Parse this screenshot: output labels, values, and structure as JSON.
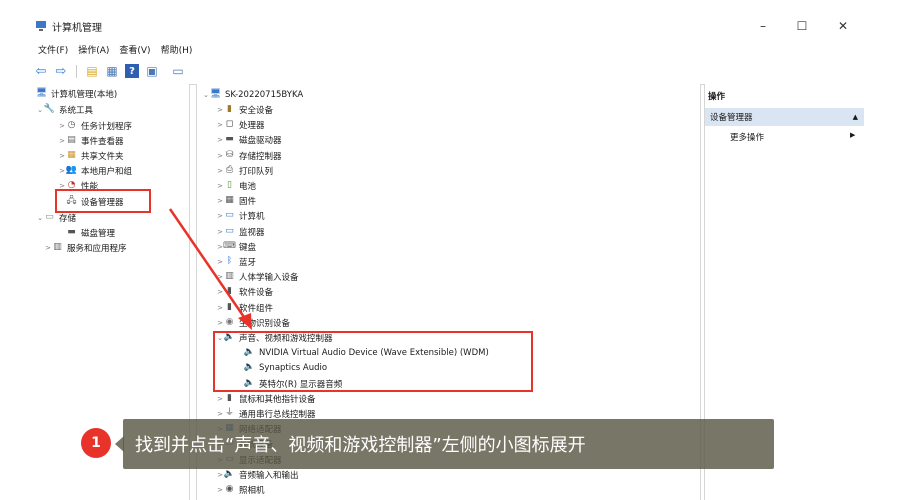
{
  "window": {
    "title": "计算机管理",
    "minimize_glyph": "–",
    "maximize_glyph": "☐",
    "close_glyph": "✕"
  },
  "menu": [
    {
      "label": "文件(F)"
    },
    {
      "label": "操作(A)"
    },
    {
      "label": "查看(V)"
    },
    {
      "label": "帮助(H)"
    }
  ],
  "toolbar": [
    {
      "icon": "back-icon",
      "glyph": "⇦",
      "color": "#2f7fd6"
    },
    {
      "icon": "forward-icon",
      "glyph": "⇨",
      "color": "#2f7fd6"
    },
    {
      "icon": "up-folder-icon",
      "glyph": "▤",
      "color": "#d9a520"
    },
    {
      "icon": "show-hide-tree-icon",
      "glyph": "▦",
      "color": "#4a79b5"
    },
    {
      "icon": "help-icon",
      "glyph": "?",
      "color": "#2f5fb0"
    },
    {
      "icon": "properties-icon",
      "glyph": "▣",
      "color": "#4a79b5"
    },
    {
      "icon": "console-icon",
      "glyph": "▭",
      "color": "#4a79b5"
    }
  ],
  "left_tree": [
    {
      "label": "计算机管理(本地)",
      "icon": "computer-management-icon",
      "glyph": "🖥",
      "expander": ""
    },
    {
      "label": "系统工具",
      "icon": "system-tools-icon",
      "glyph": "🔧",
      "expander": "⌄"
    },
    {
      "label": "任务计划程序",
      "icon": "task-scheduler-icon",
      "glyph": "◷",
      "expander": ">"
    },
    {
      "label": "事件查看器",
      "icon": "event-viewer-icon",
      "glyph": "▤",
      "expander": ">"
    },
    {
      "label": "共享文件夹",
      "icon": "shared-folders-icon",
      "glyph": "▦",
      "expander": ">"
    },
    {
      "label": "本地用户和组",
      "icon": "local-users-icon",
      "glyph": "👥",
      "expander": ">"
    },
    {
      "label": "性能",
      "icon": "performance-icon",
      "glyph": "◔",
      "expander": ">"
    },
    {
      "label": "设备管理器",
      "icon": "device-manager-icon",
      "glyph": "🖧",
      "expander": ""
    },
    {
      "label": "存储",
      "icon": "storage-icon",
      "glyph": "▭",
      "expander": "⌄"
    },
    {
      "label": "磁盘管理",
      "icon": "disk-management-icon",
      "glyph": "▬",
      "expander": ""
    },
    {
      "label": "服务和应用程序",
      "icon": "services-apps-icon",
      "glyph": "▥",
      "expander": ">"
    }
  ],
  "device_tree": {
    "root": {
      "label": "SK-20220715BYKA",
      "icon": "computer-icon",
      "glyph": "🖥"
    },
    "items": [
      {
        "label": "安全设备",
        "icon": "security-device-icon",
        "glyph": "▮",
        "expander": ">"
      },
      {
        "label": "处理器",
        "icon": "processor-icon",
        "glyph": "◻",
        "expander": ">"
      },
      {
        "label": "磁盘驱动器",
        "icon": "disk-drive-icon",
        "glyph": "▬",
        "expander": ">"
      },
      {
        "label": "存储控制器",
        "icon": "storage-controller-icon",
        "glyph": "⛁",
        "expander": ">"
      },
      {
        "label": "打印队列",
        "icon": "print-queue-icon",
        "glyph": "⎙",
        "expander": ">"
      },
      {
        "label": "电池",
        "icon": "battery-icon",
        "glyph": "▯",
        "expander": ">"
      },
      {
        "label": "固件",
        "icon": "firmware-icon",
        "glyph": "▦",
        "expander": ">"
      },
      {
        "label": "计算机",
        "icon": "computer-node-icon",
        "glyph": "▭",
        "expander": ">"
      },
      {
        "label": "监视器",
        "icon": "monitor-icon",
        "glyph": "▭",
        "expander": ">"
      },
      {
        "label": "键盘",
        "icon": "keyboard-icon",
        "glyph": "⌨",
        "expander": ">"
      },
      {
        "label": "蓝牙",
        "icon": "bluetooth-icon",
        "glyph": "ᛒ",
        "expander": ">"
      },
      {
        "label": "人体学输入设备",
        "icon": "hid-icon",
        "glyph": "▥",
        "expander": ">"
      },
      {
        "label": "软件设备",
        "icon": "software-device-icon",
        "glyph": "▮",
        "expander": ">"
      },
      {
        "label": "软件组件",
        "icon": "software-component-icon",
        "glyph": "▮",
        "expander": ">"
      },
      {
        "label": "生物识别设备",
        "icon": "biometric-icon",
        "glyph": "◉",
        "expander": ">"
      },
      {
        "label": "声音、视频和游戏控制器",
        "icon": "sound-controller-icon",
        "glyph": "🔈",
        "expander": "⌄"
      },
      {
        "label": "NVIDIA Virtual Audio Device (Wave Extensible) (WDM)",
        "icon": "audio-device-icon",
        "glyph": "🔈",
        "expander": "",
        "child": true
      },
      {
        "label": "Synaptics Audio",
        "icon": "audio-device-icon",
        "glyph": "🔈",
        "expander": "",
        "child": true
      },
      {
        "label": "英特尔(R) 显示器音频",
        "icon": "audio-device-icon",
        "glyph": "🔈",
        "expander": "",
        "child": true
      },
      {
        "label": "鼠标和其他指针设备",
        "icon": "mouse-icon",
        "glyph": "▮",
        "expander": ">"
      },
      {
        "label": "通用串行总线控制器",
        "icon": "usb-icon",
        "glyph": "⏚",
        "expander": ">"
      },
      {
        "label": "网络适配器",
        "icon": "network-adapter-icon",
        "glyph": "▦",
        "expander": ">"
      },
      {
        "label": "系统设备",
        "icon": "system-device-icon",
        "glyph": "▭",
        "expander": ">"
      },
      {
        "label": "显示适配器",
        "icon": "display-adapter-icon",
        "glyph": "▭",
        "expander": ">"
      },
      {
        "label": "音频输入和输出",
        "icon": "audio-io-icon",
        "glyph": "🔈",
        "expander": ">"
      },
      {
        "label": "照相机",
        "icon": "camera-icon",
        "glyph": "◉",
        "expander": ">"
      }
    ]
  },
  "actions_pane": {
    "header": "操作",
    "selected": "设备管理器",
    "more": "更多操作"
  },
  "annotation": {
    "step": "1",
    "text": "找到并点击“声音、视频和游戏控制器”左侧的小图标展开"
  },
  "colors": {
    "highlight_red": "#e8332a",
    "selection_blue": "#d9e5f3"
  }
}
